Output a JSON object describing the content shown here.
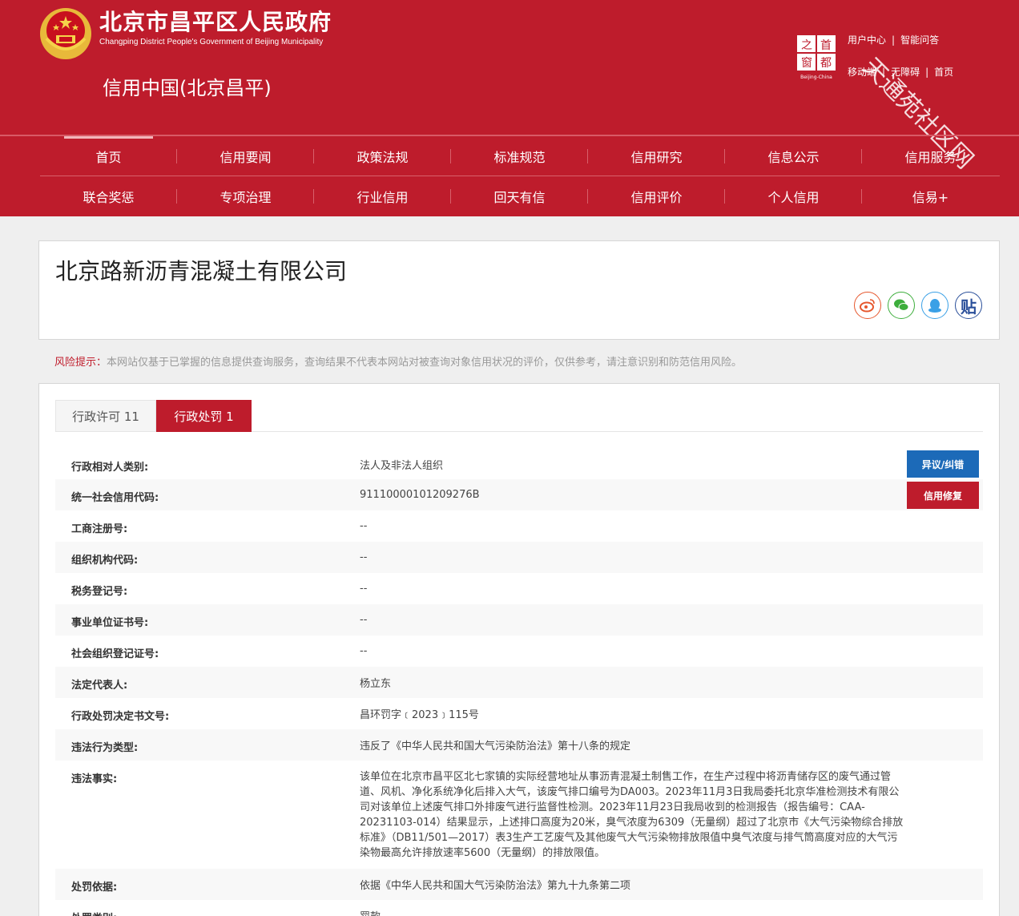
{
  "header": {
    "site_title": "北京市昌平区人民政府",
    "site_subtitle": "Changping District People's Government of Beijing Municipality",
    "credit_title": "信用中国(北京昌平)",
    "capital_logo_chars": [
      "之",
      "首",
      "窗",
      "都"
    ],
    "capital_logo_caption": "Beijing-China",
    "links_row1": [
      "用户中心",
      "智能问答"
    ],
    "links_row2": [
      "移动端",
      "无障碍",
      "首页"
    ],
    "watermark": "天通苑社区网"
  },
  "nav": {
    "row1": [
      "首页",
      "信用要闻",
      "政策法规",
      "标准规范",
      "信用研究",
      "信息公示",
      "信用服务"
    ],
    "row2": [
      "联合奖惩",
      "专项治理",
      "行业信用",
      "回天有信",
      "信用评价",
      "个人信用",
      "信易+"
    ]
  },
  "company": {
    "name": "北京路新沥青混凝土有限公司",
    "share_icons": [
      "weibo-icon",
      "wechat-icon",
      "qq-icon",
      "tieba-icon"
    ],
    "tieba_label": "贴"
  },
  "risk": {
    "label": "风险提示：",
    "text": "本网站仅基于已掌握的信息提供查询服务，查询结果不代表本网站对被查询对象信用状况的评价，仅供参考，请注意识别和防范信用风险。"
  },
  "tabs": {
    "permit": "行政许可 11",
    "penalty": "行政处罚 1"
  },
  "buttons": {
    "objection": "异议/纠错",
    "repair": "信用修复"
  },
  "details": [
    {
      "label": "行政相对人类别:",
      "value": "法人及非法人组织"
    },
    {
      "label": "统一社会信用代码:",
      "value": "91110000101209276B"
    },
    {
      "label": "工商注册号:",
      "value": "--"
    },
    {
      "label": "组织机构代码:",
      "value": "--"
    },
    {
      "label": "税务登记号:",
      "value": "--"
    },
    {
      "label": "事业单位证书号:",
      "value": "--"
    },
    {
      "label": "社会组织登记证号:",
      "value": "--"
    },
    {
      "label": "法定代表人:",
      "value": "杨立东"
    },
    {
      "label": "行政处罚决定书文号:",
      "value": "昌环罚字﹝2023﹞115号"
    },
    {
      "label": "违法行为类型:",
      "value": "违反了《中华人民共和国大气污染防治法》第十八条的规定"
    },
    {
      "label": "违法事实:",
      "value": "该单位在北京市昌平区北七家镇的实际经营地址从事沥青混凝土制售工作，在生产过程中将沥青储存区的废气通过管道、风机、净化系统净化后排入大气，该废气排口编号为DA003。2023年11月3日我局委托北京华准检测技术有限公司对该单位上述废气排口外排废气进行监督性检测。2023年11月23日我局收到的检测报告（报告编号：CAA-20231103-014）结果显示，上述排口高度为20米，臭气浓度为6309（无量纲）超过了北京市《大气污染物综合排放标准》（DB11/501—2017）表3生产工艺废气及其他废气大气污染物排放限值中臭气浓度与排气筒高度对应的大气污染物最高允许排放速率5600（无量纲）的排放限值。"
    },
    {
      "label": "处罚依据:",
      "value": "依据《中华人民共和国大气污染防治法》第九十九条第二项"
    },
    {
      "label": "处罚类别:",
      "value": "罚款"
    }
  ]
}
